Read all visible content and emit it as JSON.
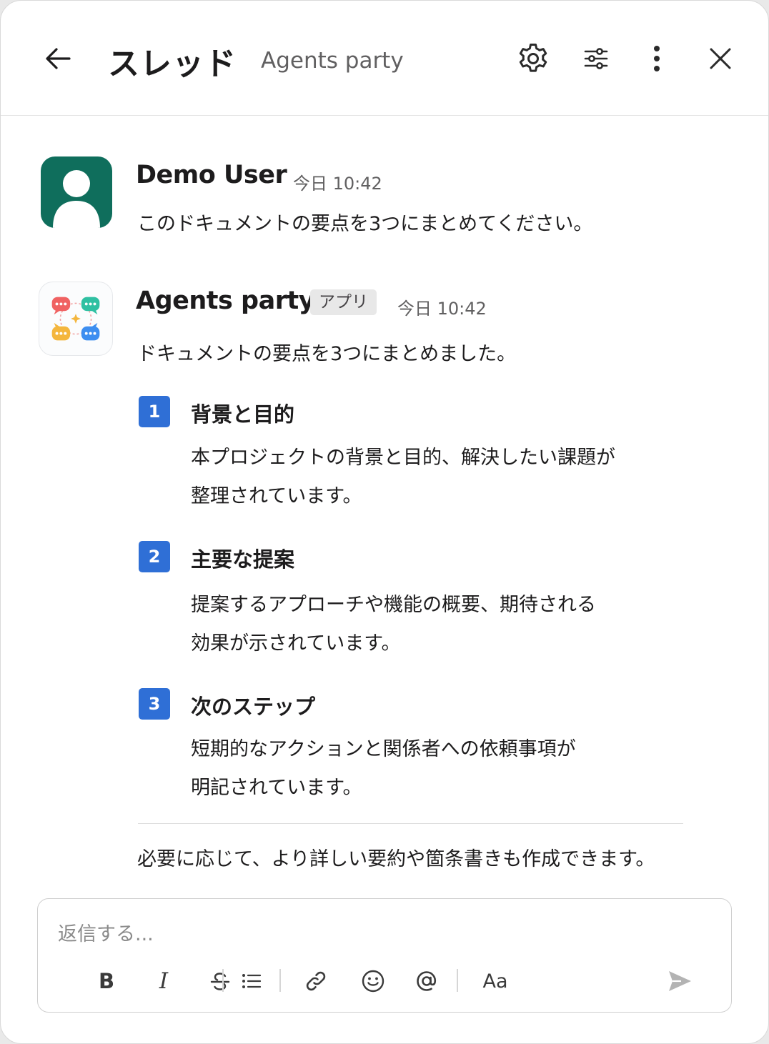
{
  "header": {
    "title": "スレッド",
    "subtitle": "Agents party"
  },
  "messages": [
    {
      "sender": "Demo User",
      "time": "今日 10:42",
      "text": "このドキュメントの要点を3つにまとめてください。"
    },
    {
      "sender": "Agents party",
      "badge": "アプリ",
      "time": "今日 10:42",
      "intro": "ドキュメントの要点を3つにまとめました。",
      "items": [
        {
          "number": "1",
          "heading": "背景と目的",
          "lines": [
            "本プロジェクトの背景と目的、解決したい課題が",
            "整理されています。"
          ]
        },
        {
          "number": "2",
          "heading": "主要な提案",
          "lines": [
            "提案するアプローチや機能の概要、期待される",
            "効果が示されています。"
          ]
        },
        {
          "number": "3",
          "heading": "次のステップ",
          "lines": [
            "短期的なアクションと関係者への依頼事項が",
            "明記されています。"
          ]
        }
      ],
      "footer": "必要に応じて、より詳しい要約や箇条書きも作成できます。"
    }
  ],
  "composer": {
    "placeholder": "返信する...",
    "value": "",
    "toolbar": {
      "bold": "B",
      "italic": "I",
      "font_size": "Aa"
    }
  },
  "colors": {
    "accent": "#2f6fd6",
    "user_avatar": "#0f6e5c"
  }
}
